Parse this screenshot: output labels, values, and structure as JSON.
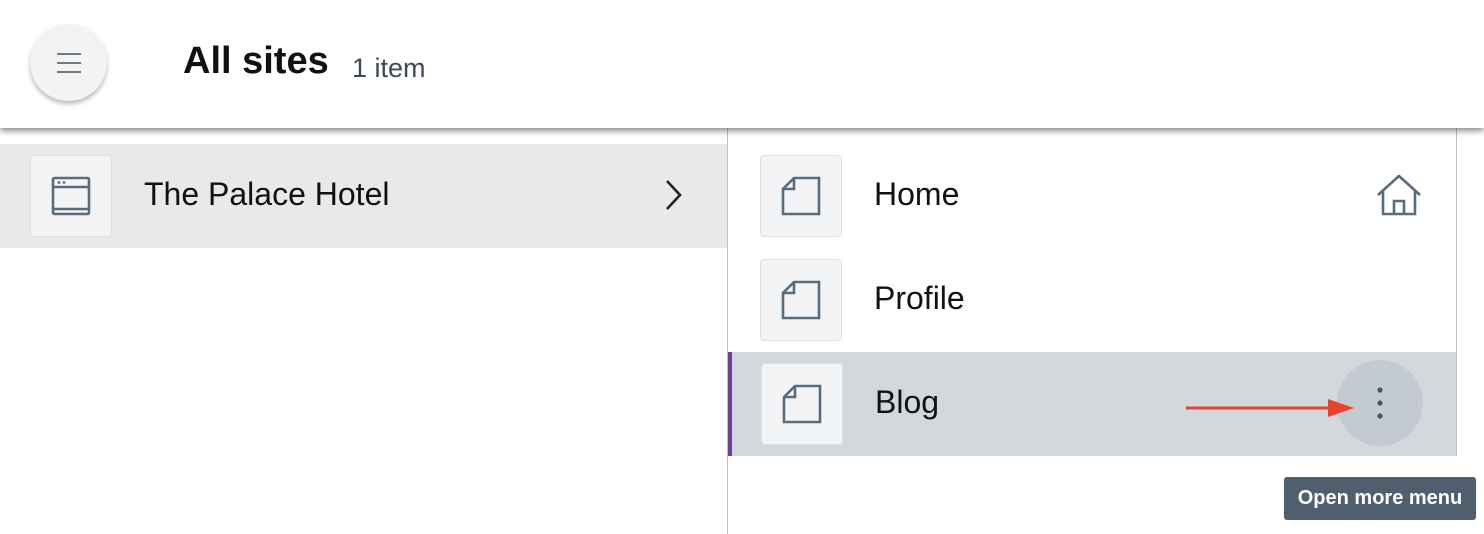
{
  "header": {
    "menu_icon": "hamburger-icon",
    "title": "All sites",
    "item_count": "1 item"
  },
  "sites": [
    {
      "label": "The Palace Hotel",
      "icon": "site-icon",
      "expand_icon": "chevron-right-icon"
    }
  ],
  "pages": [
    {
      "label": "Home",
      "icon": "page-icon",
      "badge_icon": "home-icon"
    },
    {
      "label": "Profile",
      "icon": "page-icon"
    },
    {
      "label": "Blog",
      "icon": "page-icon",
      "action_icon": "more-vertical-icon",
      "selected": true
    }
  ],
  "tooltip": {
    "text": "Open more menu"
  },
  "colors": {
    "accent": "#6b3fa0",
    "annotation_arrow": "#e8432e",
    "tooltip_bg": "#4f5f6e",
    "selected_row": "#d3d8dd",
    "icon_stroke": "#5a6b7b"
  }
}
